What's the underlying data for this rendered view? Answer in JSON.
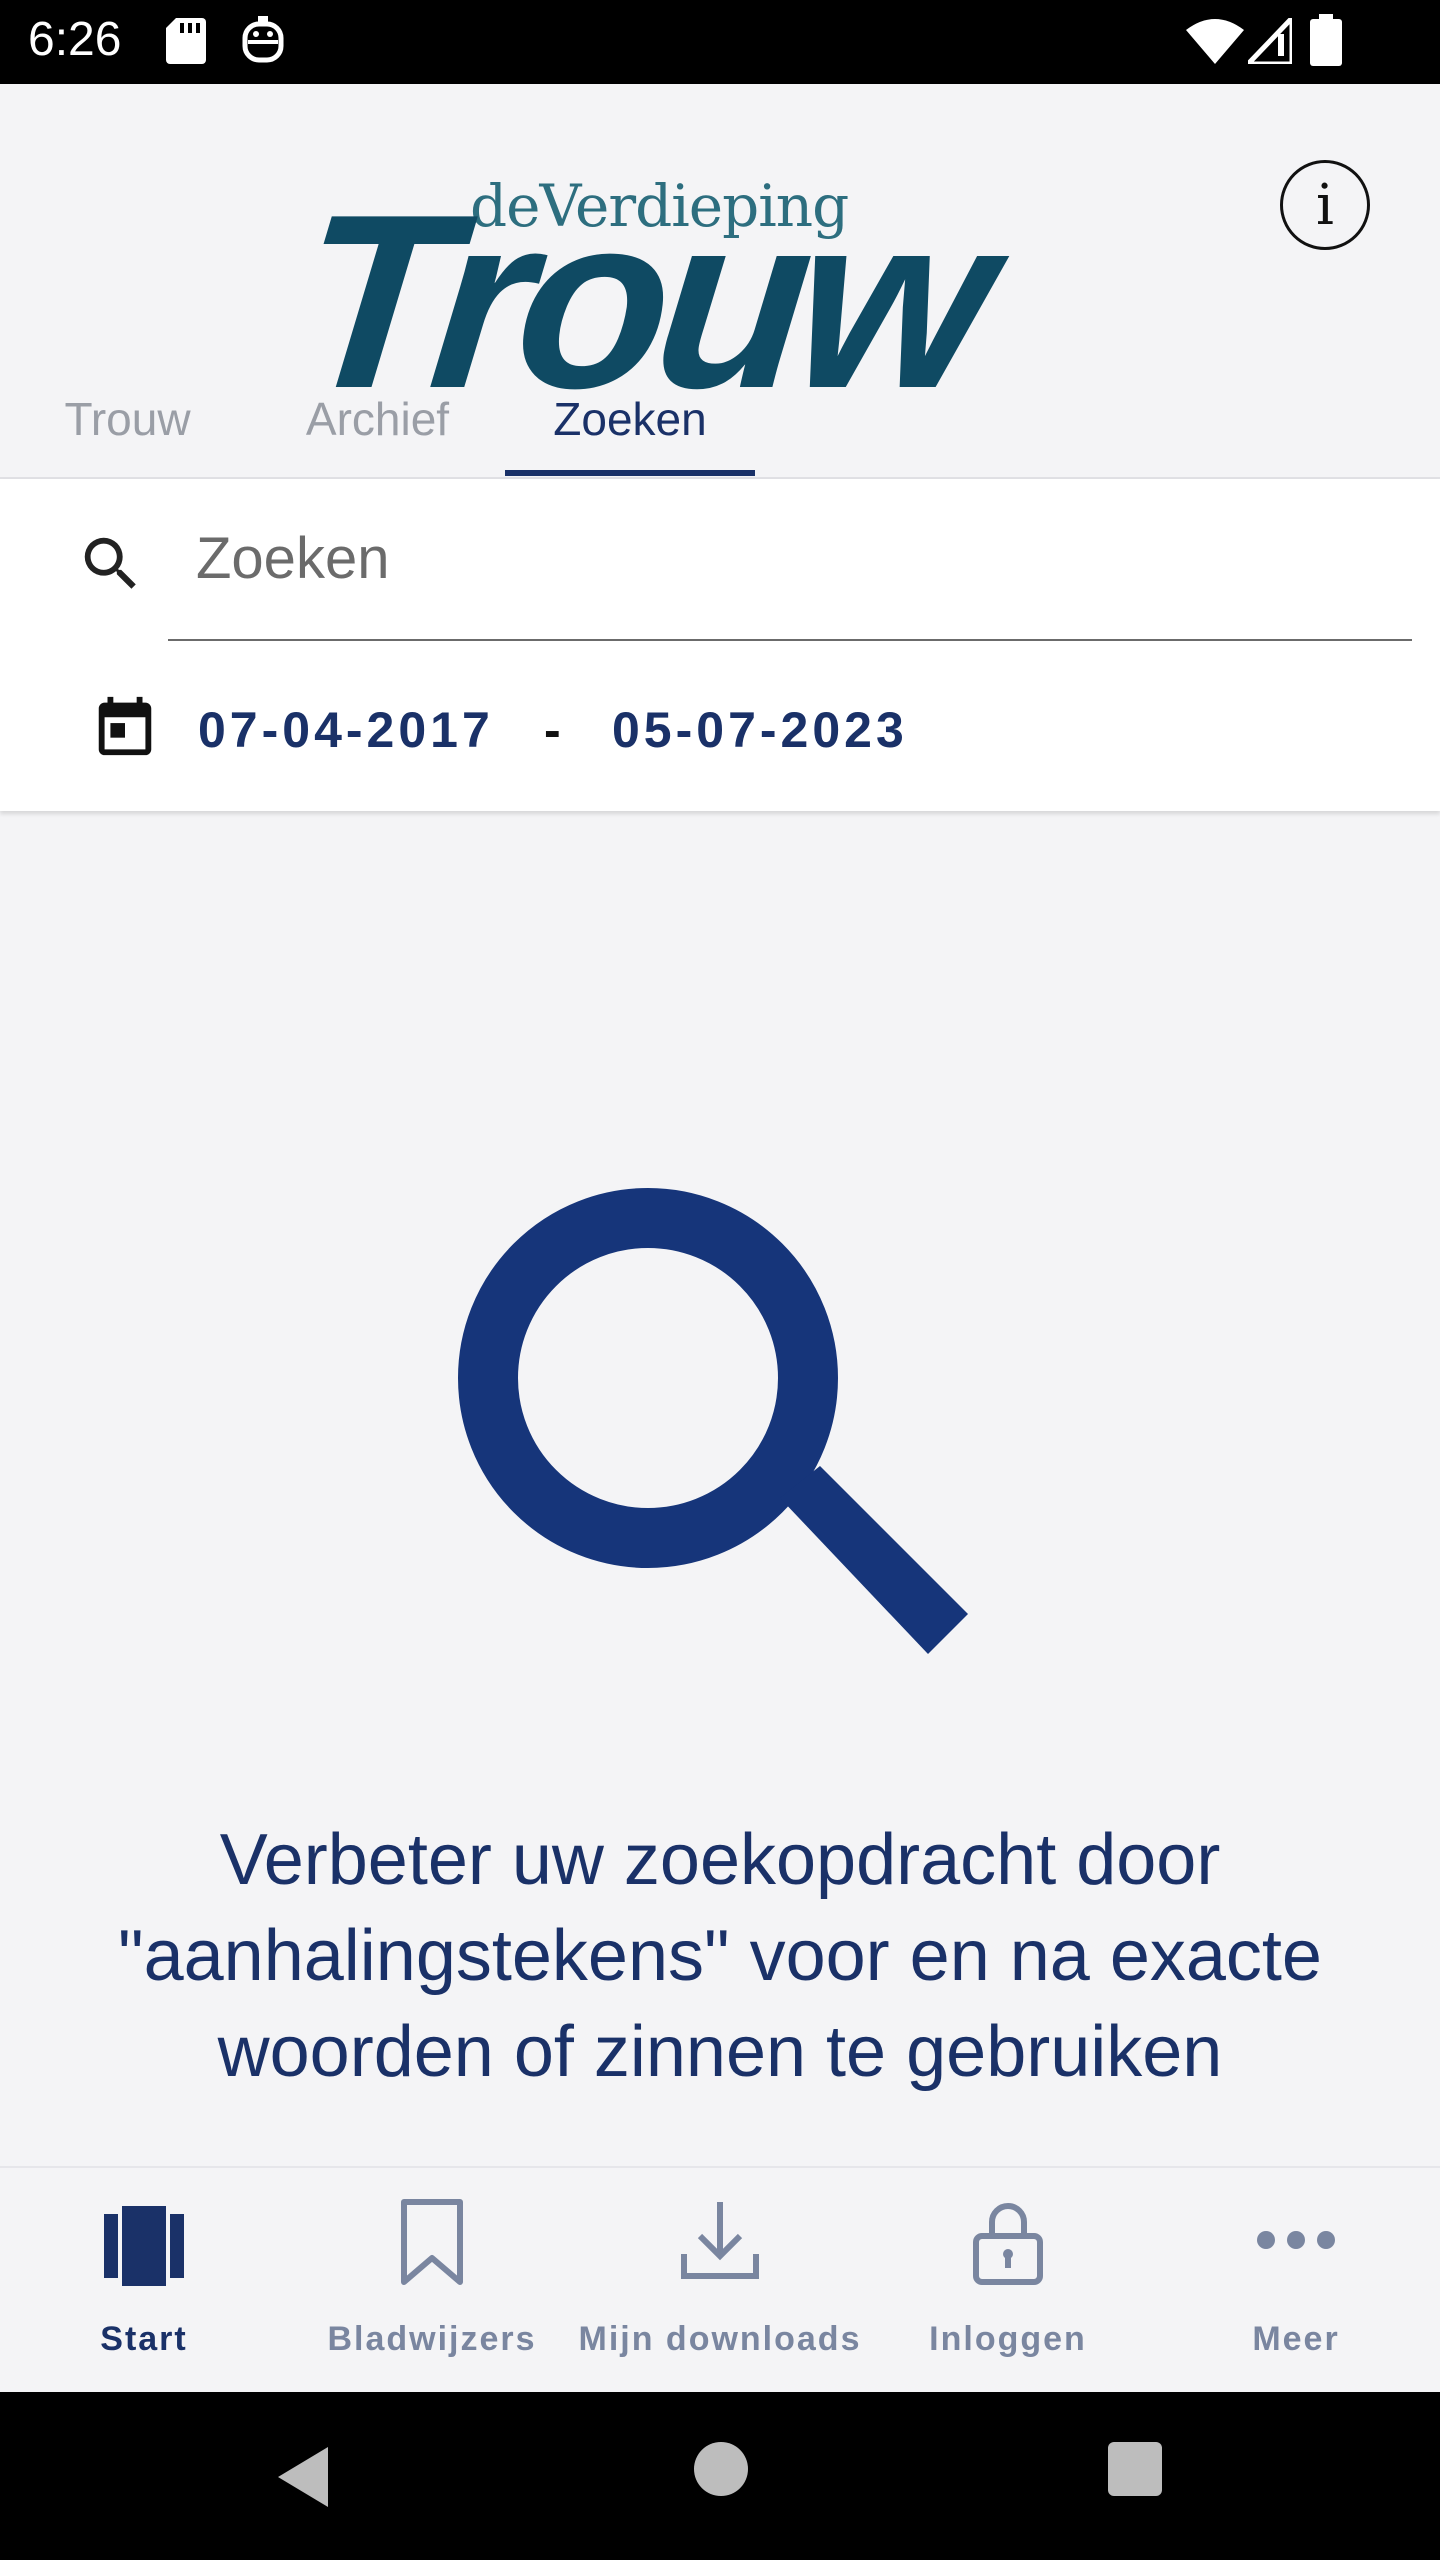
{
  "status_bar": {
    "time": "6:26",
    "icons": [
      "sd-card-icon",
      "face-icon",
      "wifi-icon",
      "signal-icon",
      "battery-icon"
    ]
  },
  "header": {
    "logo_sub": "deVerdieping",
    "logo_main": "Trouw",
    "info_label": "i"
  },
  "tabs": [
    {
      "label": "Trouw",
      "active": false
    },
    {
      "label": "Archief",
      "active": false
    },
    {
      "label": "Zoeken",
      "active": true
    }
  ],
  "search": {
    "placeholder": "Zoeken",
    "value": "",
    "date_from": "07-04-2017",
    "date_separator": "-",
    "date_to": "05-07-2023"
  },
  "empty_state": {
    "hint": "Verbeter uw zoekopdracht door \"aanhalingstekens\" voor en na exacte woorden of zinnen te gebruiken"
  },
  "bottom_nav": [
    {
      "label": "Start",
      "icon": "book-icon",
      "active": true
    },
    {
      "label": "Bladwijzers",
      "icon": "bookmark-icon",
      "active": false
    },
    {
      "label": "Mijn downloads",
      "icon": "download-icon",
      "active": false
    },
    {
      "label": "Inloggen",
      "icon": "lock-icon",
      "active": false
    },
    {
      "label": "Meer",
      "icon": "more-icon",
      "active": false
    }
  ],
  "colors": {
    "brand": "#0f4a63",
    "accent": "#1a3168",
    "inactive": "#7a86a0",
    "background": "#f4f4f6"
  }
}
